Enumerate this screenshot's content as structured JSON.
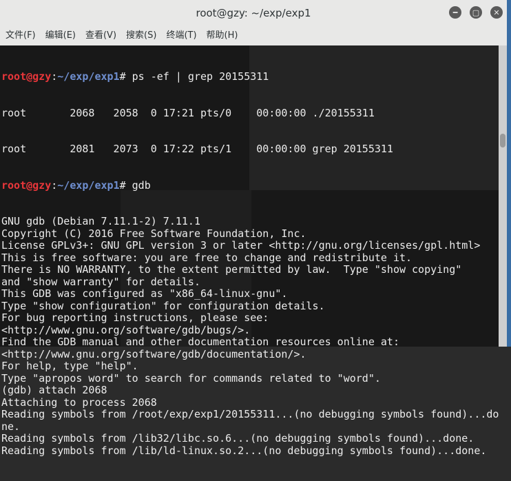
{
  "window": {
    "title": "root@gzy: ~/exp/exp1",
    "controls": [
      "minimize",
      "maximize",
      "close"
    ]
  },
  "menu": [
    "文件(F)",
    "编辑(E)",
    "查看(V)",
    "搜索(S)",
    "终端(T)",
    "帮助(H)"
  ],
  "prompt": {
    "user": "root@gzy",
    "sep": ":",
    "path": "~/exp/exp1",
    "symbol": "# "
  },
  "colors": {
    "prompt_user": "#e8363a",
    "prompt_path": "#6f8fd0",
    "terminal_bg": "#080808",
    "text": "#ececec"
  },
  "terminal": {
    "cmd1": "ps -ef | grep 20155311",
    "cmd2": "gdb",
    "lines_a": [
      "root       2068   2058  0 17:21 pts/0    00:00:00 ./20155311",
      "root       2081   2073  0 17:22 pts/1    00:00:00 grep 20155311"
    ],
    "lines_b": [
      "GNU gdb (Debian 7.11.1-2) 7.11.1",
      "Copyright (C) 2016 Free Software Foundation, Inc.",
      "License GPLv3+: GNU GPL version 3 or later <http://gnu.org/licenses/gpl.html>",
      "This is free software: you are free to change and redistribute it.",
      "There is NO WARRANTY, to the extent permitted by law.  Type \"show copying\"",
      "and \"show warranty\" for details.",
      "This GDB was configured as \"x86_64-linux-gnu\".",
      "Type \"show configuration\" for configuration details.",
      "For bug reporting instructions, please see:",
      "<http://www.gnu.org/software/gdb/bugs/>.",
      "Find the GDB manual and other documentation resources online at:",
      "<http://www.gnu.org/software/gdb/documentation/>.",
      "For help, type \"help\".",
      "Type \"apropos word\" to search for commands related to \"word\".",
      "(gdb) attach 2068",
      "Attaching to process 2068",
      "Reading symbols from /root/exp/exp1/20155311...(no debugging symbols found)...do",
      "ne.",
      "Reading symbols from /lib32/libc.so.6...(no debugging symbols found)...done.",
      "Reading symbols from /lib/ld-linux.so.2...(no debugging symbols found)...done."
    ]
  }
}
